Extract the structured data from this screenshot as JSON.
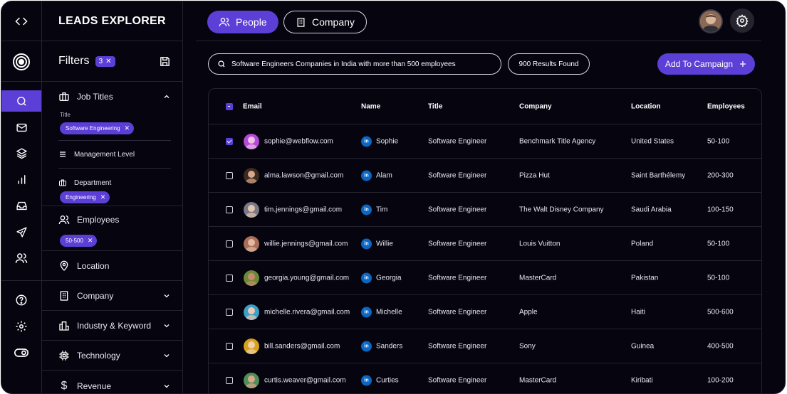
{
  "app": {
    "title": "LEADS EXPLORER"
  },
  "filters": {
    "title": "Filters",
    "count": "3",
    "job_titles": {
      "label": "Job Titles",
      "title_label": "Title",
      "title_chip": "Software Engineering",
      "management_level": "Management Level",
      "department_label": "Department",
      "department_chip": "Engineering"
    },
    "employees": {
      "label": "Employees",
      "chip": "50-500"
    },
    "location": {
      "label": "Location"
    },
    "company": {
      "label": "Company"
    },
    "industry": {
      "label": "Industry & Keyword"
    },
    "technology": {
      "label": "Technology"
    },
    "revenue": {
      "label": "Revenue"
    }
  },
  "tabs": {
    "people": "People",
    "company": "Company"
  },
  "search": {
    "value": "Software Engineers Companies in India with more than 500 employees"
  },
  "results": "900 Results Found",
  "add_button": "Add To Campaign",
  "table": {
    "headers": {
      "email": "Email",
      "name": "Name",
      "title": "Title",
      "company": "Company",
      "location": "Location",
      "employees": "Employees"
    },
    "rows": [
      {
        "email": "sophie@webflow.com",
        "name": "Sophie",
        "title": "Software Engineer",
        "company": "Benchmark Title Agency",
        "location": "United States",
        "employees": "50-100",
        "checked": true
      },
      {
        "email": "alma.lawson@gmail.com",
        "name": "Alam",
        "title": "Software Engineer",
        "company": "Pizza Hut",
        "location": "Saint Barthélemy",
        "employees": "200-300",
        "checked": false
      },
      {
        "email": "tim.jennings@gmail.com",
        "name": "Tim",
        "title": "Software Engineer",
        "company": "The Walt Disney Company",
        "location": "Saudi Arabia",
        "employees": "100-150",
        "checked": false
      },
      {
        "email": "willie.jennings@gmail.com",
        "name": "Willie",
        "title": "Software Engineer",
        "company": "Louis Vuitton",
        "location": "Poland",
        "employees": "50-100",
        "checked": false
      },
      {
        "email": "georgia.young@gmail.com",
        "name": "Georgia",
        "title": "Software Engineer",
        "company": "MasterCard",
        "location": "Pakistan",
        "employees": "50-100",
        "checked": false
      },
      {
        "email": "michelle.rivera@gmail.com",
        "name": "Michelle",
        "title": "Software Engineer",
        "company": "Apple",
        "location": "Haiti",
        "employees": "500-600",
        "checked": false
      },
      {
        "email": "bill.sanders@gmail.com",
        "name": "Sanders",
        "title": "Software Engineer",
        "company": "Sony",
        "location": "Guinea",
        "employees": "400-500",
        "checked": false
      },
      {
        "email": "curtis.weaver@gmail.com",
        "name": "Curties",
        "title": "Software Engineer",
        "company": "MasterCard",
        "location": "Kiribati",
        "employees": "100-200",
        "checked": false
      }
    ]
  },
  "colors": {
    "accent": "#5b3fd6",
    "background": "#05040f",
    "linkedin": "#0a66c2"
  }
}
